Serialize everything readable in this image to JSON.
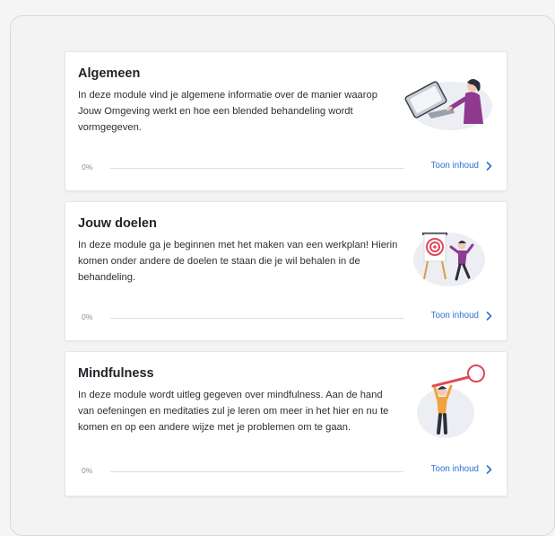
{
  "modules": [
    {
      "title": "Algemeen",
      "description": "In deze module vind je algemene informatie over de manier waarop Jouw Omgeving werkt en hoe een blended behandeling wordt vormgegeven.",
      "progress_label": "0%",
      "progress": 0,
      "link_label": "Toon inhoud",
      "illustration": "person-at-laptop-illustration"
    },
    {
      "title": "Jouw doelen",
      "description": "In deze module ga je beginnen met het maken van een werkplan! Hierin komen onder andere de doelen te staan die je wil behalen in de behandeling.",
      "progress_label": "0%",
      "progress": 0,
      "link_label": "Toon inhoud",
      "illustration": "target-on-easel-illustration"
    },
    {
      "title": "Mindfulness",
      "description": "In deze module wordt uitleg gegeven over mindfulness. Aan de hand van oefeningen en meditaties zul je leren om meer in het hier en nu te komen en op een andere wijze met je problemen om te gaan.",
      "progress_label": "0%",
      "progress": 0,
      "link_label": "Toon inhoud",
      "illustration": "person-with-magnifier-illustration"
    }
  ],
  "colors": {
    "accent": "#2e6fd8",
    "illustration_purple": "#8e3b8f",
    "illustration_red": "#e0475b",
    "illustration_bg": "#eceef3"
  }
}
